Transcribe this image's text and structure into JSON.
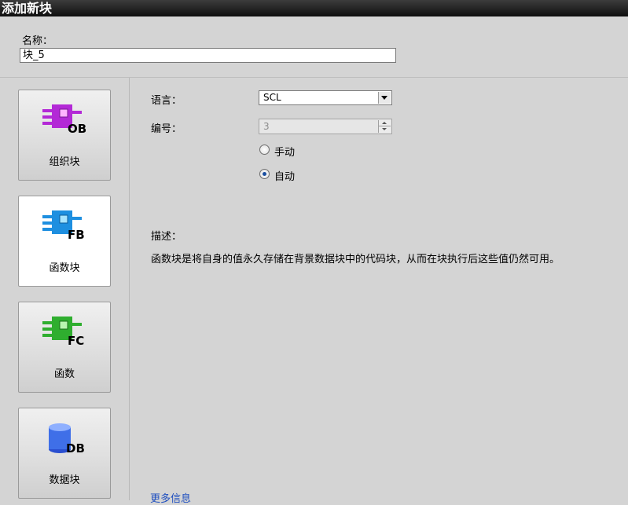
{
  "window": {
    "title": "添加新块"
  },
  "name": {
    "label": "名称：",
    "value": "块_5"
  },
  "blocks": [
    {
      "id": "ob",
      "code": "OB",
      "label": "组织块",
      "color": "#b329d6"
    },
    {
      "id": "fb",
      "code": "FB",
      "label": "函数块",
      "color": "#1e8fe0"
    },
    {
      "id": "fc",
      "code": "FC",
      "label": "函数",
      "color": "#2fae2f"
    },
    {
      "id": "db",
      "code": "DB",
      "label": "数据块",
      "color": "#3f6fe8"
    }
  ],
  "selected_block": "fb",
  "language": {
    "label": "语言：",
    "value": "SCL"
  },
  "number": {
    "label": "编号：",
    "value": "3"
  },
  "numbering_mode": {
    "options": [
      {
        "label": "手动",
        "checked": false
      },
      {
        "label": "自动",
        "checked": true
      }
    ]
  },
  "description": {
    "title": "描述：",
    "text": "函数块是将自身的值永久存储在背景数据块中的代码块，从而在块执行后这些值仍然可用。"
  },
  "more_info": "更多信息"
}
